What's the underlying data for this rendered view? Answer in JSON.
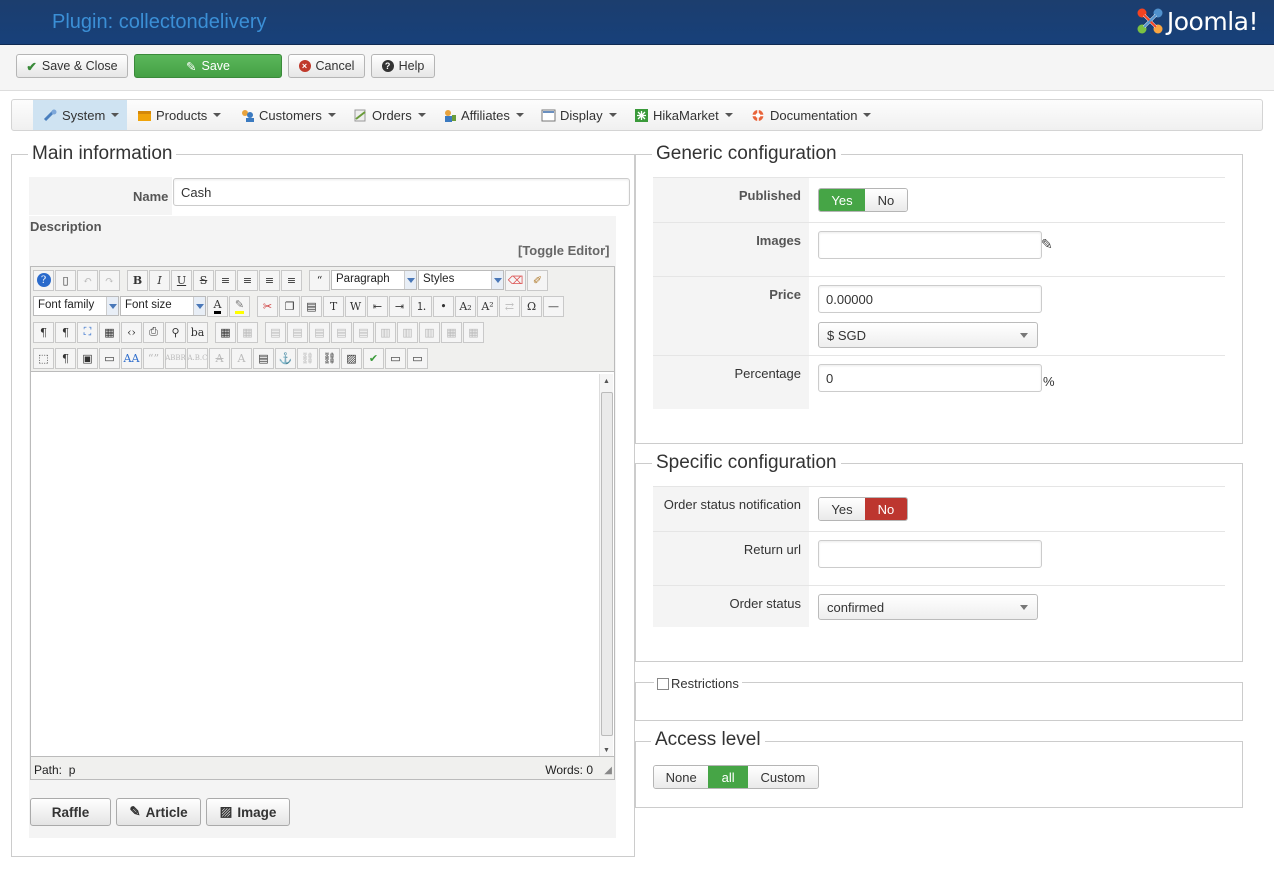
{
  "header": {
    "title": "Plugin: collectondelivery",
    "brand": "Joomla!"
  },
  "toolbar": {
    "save_close": "Save & Close",
    "save": "Save",
    "cancel": "Cancel",
    "help": "Help"
  },
  "menu": [
    {
      "label": "System",
      "icon": "tools-icon",
      "active": true
    },
    {
      "label": "Products",
      "icon": "box-icon"
    },
    {
      "label": "Customers",
      "icon": "users-icon"
    },
    {
      "label": "Orders",
      "icon": "orders-icon"
    },
    {
      "label": "Affiliates",
      "icon": "affiliates-icon"
    },
    {
      "label": "Display",
      "icon": "display-icon"
    },
    {
      "label": "HikaMarket",
      "icon": "market-icon"
    },
    {
      "label": "Documentation",
      "icon": "lifebuoy-icon"
    }
  ],
  "main": {
    "legend": "Main information",
    "name_label": "Name",
    "name_value": "Cash",
    "description_label": "Description",
    "toggle_editor": "[Toggle Editor]",
    "editor": {
      "format_select": "Paragraph",
      "styles_select": "Styles",
      "font_family": "Font family",
      "font_size": "Font size",
      "path_label": "Path:",
      "path_value": "p",
      "words": "Words: 0"
    },
    "buttons": {
      "raffle": "Raffle",
      "article": "Article",
      "image": "Image"
    }
  },
  "generic": {
    "legend": "Generic configuration",
    "published_label": "Published",
    "yes": "Yes",
    "no": "No",
    "published": "Yes",
    "images_label": "Images",
    "images_value": "",
    "price_label": "Price",
    "price_value": "0.00000",
    "currency": "$ SGD",
    "percentage_label": "Percentage",
    "percentage_value": "0",
    "percent_sign": "%"
  },
  "specific": {
    "legend": "Specific configuration",
    "notify_label": "Order status notification",
    "yes": "Yes",
    "no": "No",
    "notify": "No",
    "return_label": "Return url",
    "return_value": "",
    "status_label": "Order status",
    "status_value": "confirmed"
  },
  "restrictions": {
    "label": "Restrictions",
    "checked": false
  },
  "access": {
    "legend": "Access level",
    "options": [
      "None",
      "all",
      "Custom"
    ],
    "selected": "all"
  },
  "colors": {
    "header": "#1c3e6e",
    "green": "#46a546",
    "red": "#bd362f"
  }
}
